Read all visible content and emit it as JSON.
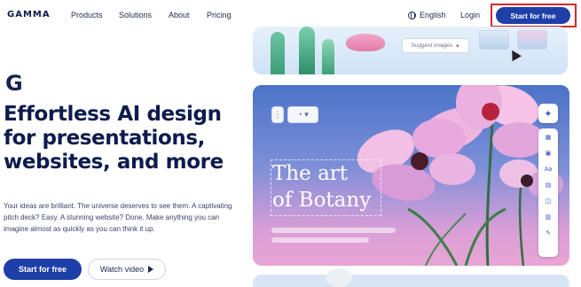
{
  "nav": {
    "logo": "GAMMA",
    "links": [
      "Products",
      "Solutions",
      "About",
      "Pricing"
    ],
    "language": "English",
    "login": "Login",
    "cta": "Start for free"
  },
  "hero": {
    "mark": "G",
    "headline_lines": [
      "Effortless AI design",
      "for presentations,",
      "websites, and more"
    ],
    "subtext": "Your ideas are brilliant. The universe deserves to see them. A captivating pitch deck? Easy. A stunning website? Done. Make anything you can imagine almost as quickly as you can think it up.",
    "primary_button": "Start for free",
    "secondary_button": "Watch video"
  },
  "preview": {
    "suggest_label": "Suggest images",
    "slide_title_lines": [
      "The art",
      "of Botany"
    ],
    "colors": {
      "brand_blue": "#1f3fa8",
      "highlight_red": "#d9252b"
    },
    "icons": [
      "sparkle-icon",
      "layout-icon",
      "image-icon",
      "text-icon",
      "photo-icon",
      "embed-icon",
      "table-icon",
      "edit-icon"
    ]
  }
}
